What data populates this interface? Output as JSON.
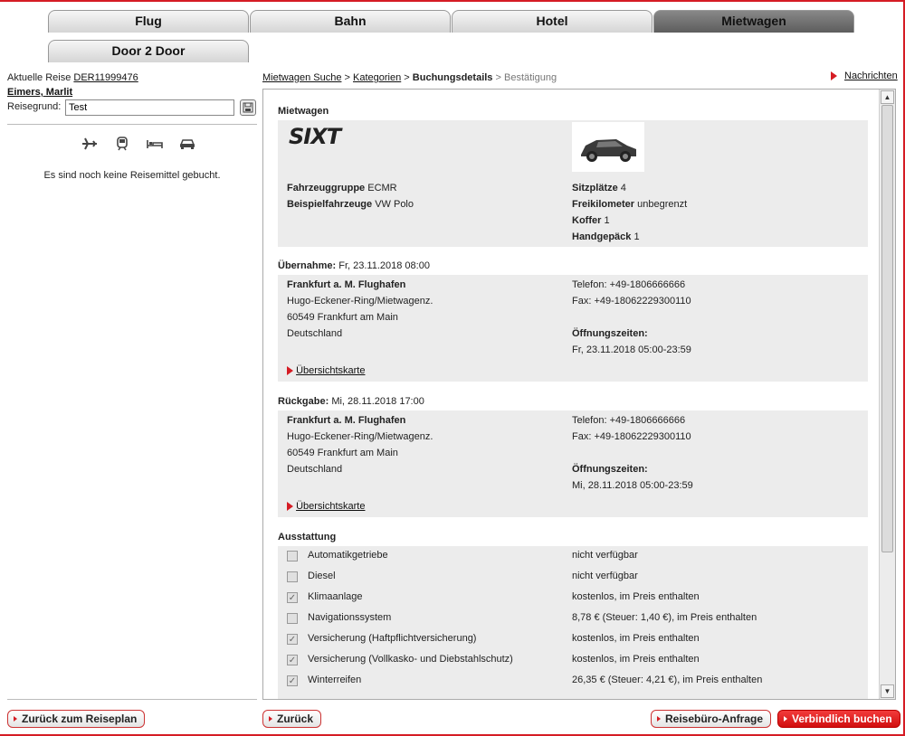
{
  "tabs": [
    {
      "label": "Flug"
    },
    {
      "label": "Bahn"
    },
    {
      "label": "Hotel"
    },
    {
      "label": "Mietwagen"
    },
    {
      "label": "Door 2 Door"
    }
  ],
  "sidebar": {
    "current_trip_label": "Aktuelle Reise",
    "current_trip_id": "DER11999476",
    "traveler": "Eimers, Marlit",
    "reason_label": "Reisegrund:",
    "reason_value": "Test",
    "icons": [
      "plane-icon",
      "train-icon",
      "hotel-bed-icon",
      "car-icon"
    ],
    "empty_text": "Es sind noch keine Reisemittel gebucht."
  },
  "breadcrumb": {
    "items": [
      "Mietwagen Suche",
      "Kategorien",
      "Buchungsdetails",
      "Bestätigung"
    ],
    "sep": ">"
  },
  "news_label": "Nachrichten",
  "car": {
    "section": "Mietwagen",
    "logo": "SIXT",
    "group_label": "Fahrzeuggruppe",
    "group_value": "ECMR",
    "example_label": "Beispielfahrzeuge",
    "example_value": "VW Polo",
    "seats_label": "Sitzplätze",
    "seats_value": "4",
    "km_label": "Freikilometer",
    "km_value": "unbegrenzt",
    "bags_label": "Koffer",
    "bags_value": "1",
    "hand_label": "Handgepäck",
    "hand_value": "1"
  },
  "pickup": {
    "label": "Übernahme:",
    "datetime": "Fr, 23.11.2018 08:00",
    "station": "Frankfurt a. M. Flughafen",
    "street": "Hugo-Eckener-Ring/Mietwagenz.",
    "city": "60549 Frankfurt am Main",
    "country": "Deutschland",
    "phone": "Telefon: +49-1806666666",
    "fax": "Fax: +49-18062229300110",
    "hours_label": "Öffnungszeiten:",
    "hours": "Fr, 23.11.2018 05:00-23:59",
    "map_link": "Übersichtskarte"
  },
  "return": {
    "label": "Rückgabe:",
    "datetime": "Mi, 28.11.2018 17:00",
    "station": "Frankfurt a. M. Flughafen",
    "street": "Hugo-Eckener-Ring/Mietwagenz.",
    "city": "60549 Frankfurt am Main",
    "country": "Deutschland",
    "phone": "Telefon: +49-1806666666",
    "fax": "Fax: +49-18062229300110",
    "hours_label": "Öffnungszeiten:",
    "hours": "Mi, 28.11.2018 05:00-23:59",
    "map_link": "Übersichtskarte"
  },
  "equipment": {
    "section": "Ausstattung",
    "items": [
      {
        "name": "Automatikgetriebe",
        "price": "nicht verfügbar",
        "checked": false
      },
      {
        "name": "Diesel",
        "price": "nicht verfügbar",
        "checked": false
      },
      {
        "name": "Klimaanlage",
        "price": "kostenlos, im Preis enthalten",
        "checked": true
      },
      {
        "name": "Navigationssystem",
        "price": "8,78 € (Steuer: 1,40 €), im Preis enthalten",
        "checked": false
      },
      {
        "name": "Versicherung (Haftpflichtversicherung)",
        "price": "kostenlos, im Preis enthalten",
        "checked": true
      },
      {
        "name": "Versicherung (Vollkasko- und Diebstahlschutz)",
        "price": "kostenlos, im Preis enthalten",
        "checked": true
      },
      {
        "name": "Winterreifen",
        "price": "26,35 € (Steuer: 4,21 €), im Preis enthalten",
        "checked": true
      }
    ]
  },
  "buttons": {
    "back_plan": "Zurück zum Reiseplan",
    "back": "Zurück",
    "agency": "Reisebüro-Anfrage",
    "book": "Verbindlich buchen"
  },
  "colors": {
    "accent": "#d51c24"
  }
}
